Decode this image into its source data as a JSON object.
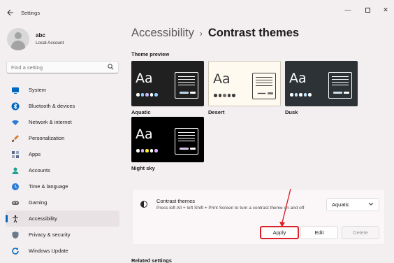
{
  "window": {
    "title": "Settings",
    "back_icon": "arrow-left-icon",
    "min_glyph": "—",
    "close_glyph": "✕"
  },
  "user": {
    "name": "abc",
    "account_type": "Local Account"
  },
  "search": {
    "placeholder": "Find a setting",
    "icon": "🔍"
  },
  "sidebar": {
    "items": [
      {
        "label": "System",
        "icon": "system-icon",
        "color": "#0067c0",
        "active": false
      },
      {
        "label": "Bluetooth & devices",
        "icon": "bluetooth-icon",
        "color": "#0067c0",
        "active": false
      },
      {
        "label": "Network & internet",
        "icon": "wifi-icon",
        "color": "#2b7bd6",
        "active": false
      },
      {
        "label": "Personalization",
        "icon": "brush-icon",
        "color": "#d97b2b",
        "active": false
      },
      {
        "label": "Apps",
        "icon": "apps-icon",
        "color": "#5a6a8a",
        "active": false
      },
      {
        "label": "Accounts",
        "icon": "person-icon",
        "color": "#20a090",
        "active": false
      },
      {
        "label": "Time & language",
        "icon": "globe-clock-icon",
        "color": "#2b7bd6",
        "active": false
      },
      {
        "label": "Gaming",
        "icon": "controller-icon",
        "color": "#666666",
        "active": false
      },
      {
        "label": "Accessibility",
        "icon": "accessibility-icon",
        "color": "#1b1b1b",
        "active": true
      },
      {
        "label": "Privacy & security",
        "icon": "shield-icon",
        "color": "#6a7a8a",
        "active": false
      },
      {
        "label": "Windows Update",
        "icon": "update-icon",
        "color": "#0067c0",
        "active": false
      }
    ]
  },
  "breadcrumb": {
    "parent": "Accessibility",
    "separator": "›",
    "current": "Contrast themes"
  },
  "preview": {
    "label": "Theme preview",
    "tile_text": "Aa",
    "themes": [
      {
        "name": "Aquatic",
        "bg": "#202020",
        "fg": "#ffffff",
        "dots": [
          "#ffffff",
          "#8fd3ff",
          "#c4b5ff",
          "#ffffff",
          "#8fd3ff"
        ],
        "accent": "#8fd3ff",
        "accent2": "#ffffff"
      },
      {
        "name": "Desert",
        "bg": "#fffaef",
        "fg": "#3d3d3d",
        "dots": [
          "#3d3d3d",
          "#3d3d3d",
          "#6e6e6e",
          "#3d3d3d",
          "#3d3d3d"
        ],
        "accent": "#3d3d3d",
        "accent2": "#6e6e6e"
      },
      {
        "name": "Dusk",
        "bg": "#2d3236",
        "fg": "#ffffff",
        "dots": [
          "#ffffff",
          "#bde6ff",
          "#ffffff",
          "#bde6ff",
          "#ffffff"
        ],
        "accent": "#bde6ff",
        "accent2": "#ffffff"
      },
      {
        "name": "Night sky",
        "bg": "#000000",
        "fg": "#ffffff",
        "dots": [
          "#ffffff",
          "#d6b4fd",
          "#ffee32",
          "#ffffff",
          "#d6b4fd"
        ],
        "accent": "#d6b4fd",
        "accent2": "#ffffff"
      }
    ]
  },
  "contrast_card": {
    "title": "Contrast themes",
    "description": "Press left Alt + left Shift + Print Screen to turn a contrast theme on and off",
    "selected_theme": "Aquatic",
    "apply_label": "Apply",
    "edit_label": "Edit",
    "delete_label": "Delete"
  },
  "related": {
    "label": "Related settings"
  },
  "colors": {
    "accent": "#0067c0",
    "highlight": "#d8232a"
  }
}
